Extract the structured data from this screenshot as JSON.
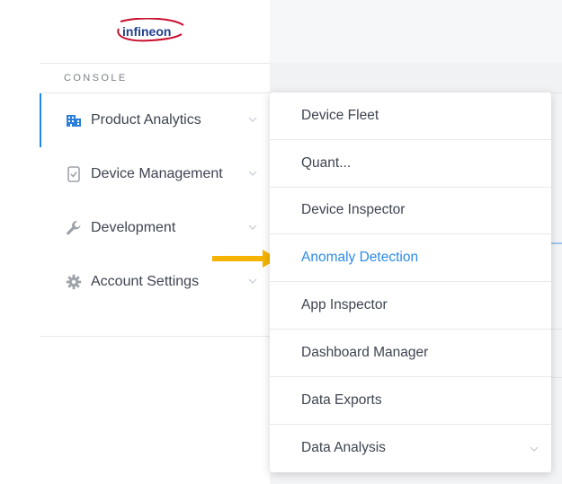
{
  "brand": {
    "logo_text": "infineon"
  },
  "console": {
    "section_label": "CONSOLE"
  },
  "sidebar": {
    "items": [
      {
        "label": "Product Analytics",
        "icon": "building-icon"
      },
      {
        "label": "Device Management",
        "icon": "device-check-icon"
      },
      {
        "label": "Development",
        "icon": "wrench-icon"
      },
      {
        "label": "Account Settings",
        "icon": "gear-icon"
      }
    ]
  },
  "dropdown": {
    "items": [
      {
        "label": "Device Fleet"
      },
      {
        "label": "Quant..."
      },
      {
        "label": "Device Inspector"
      },
      {
        "label": "Anomaly Detection",
        "highlighted": true
      },
      {
        "label": "App Inspector"
      },
      {
        "label": "Dashboard Manager"
      },
      {
        "label": "Data Exports"
      },
      {
        "label": "Data Analysis"
      }
    ]
  },
  "colors": {
    "accent": "#2b8be6",
    "arrow": "#f5b300",
    "logo_red": "#c8102e",
    "logo_blue": "#1f3f8f"
  }
}
